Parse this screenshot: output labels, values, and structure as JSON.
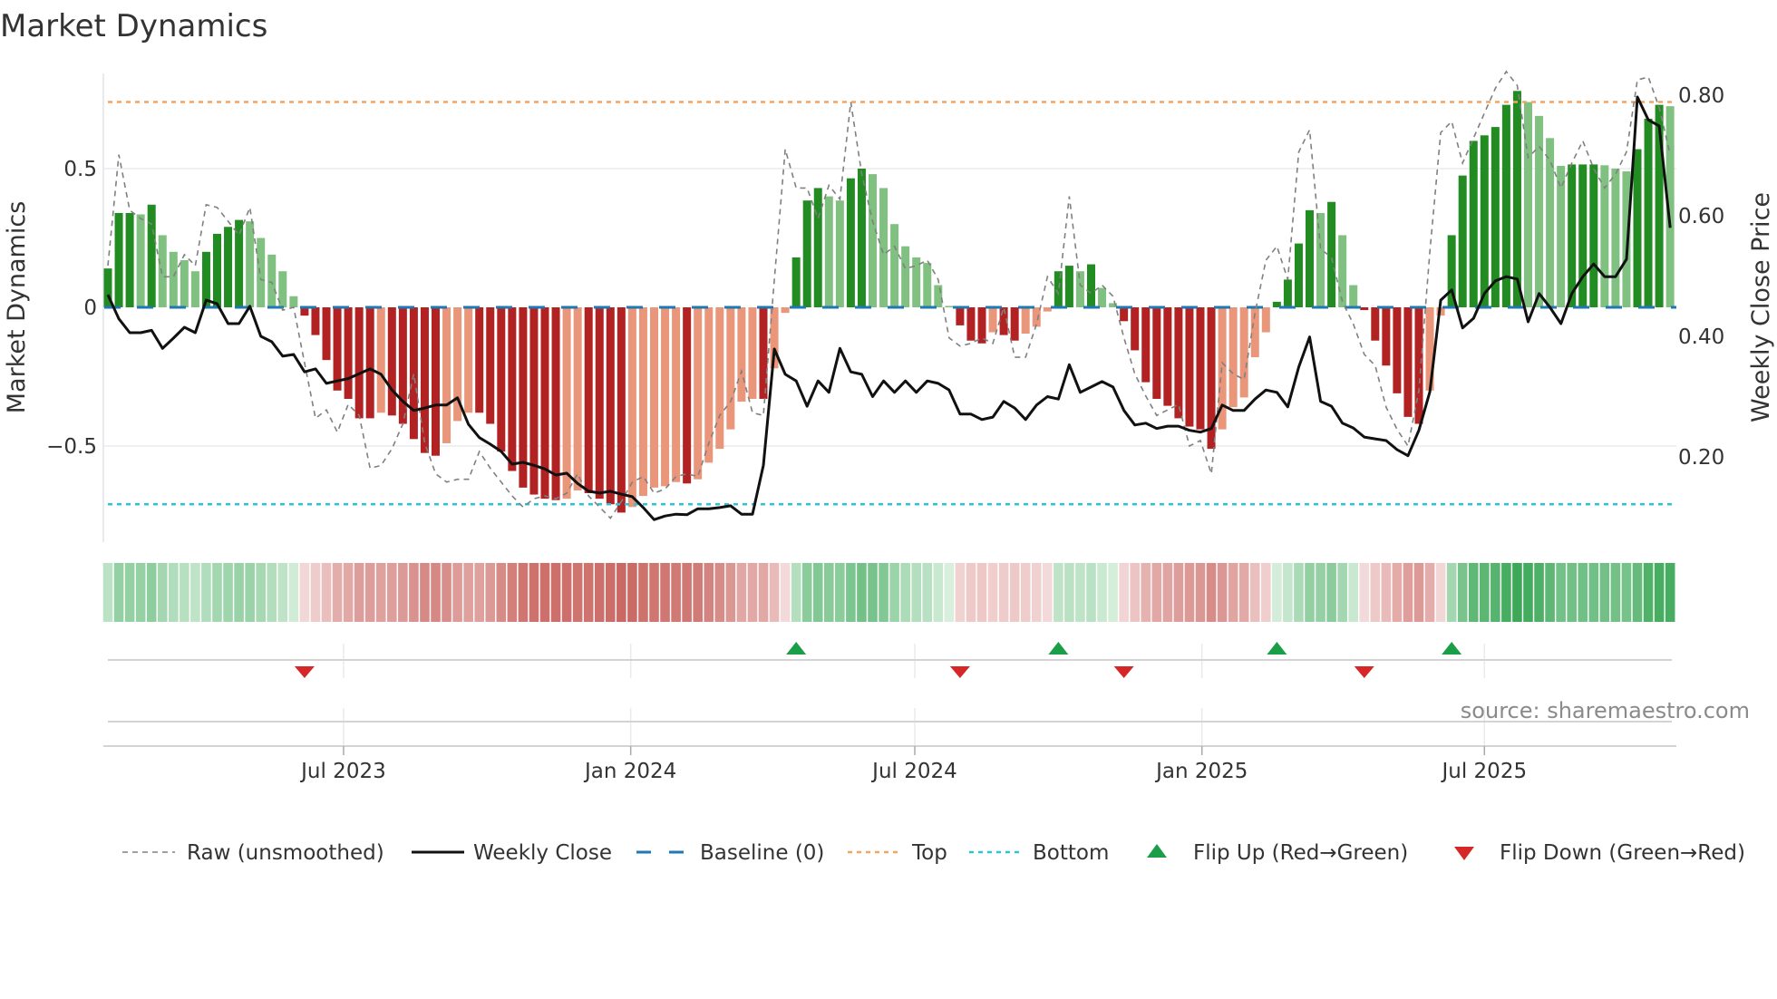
{
  "chart_data": {
    "type": "bar",
    "title": "Market Dynamics",
    "ylabel": "Market Dynamics",
    "y2label": "Weekly Close Price",
    "ylim": [
      -0.85,
      0.85
    ],
    "y2lim": [
      0.07,
      0.89
    ],
    "yticks": [
      {
        "value": 0.5,
        "label": "0.5"
      },
      {
        "value": 0,
        "label": "0"
      },
      {
        "value": -0.5,
        "label": "−0.5"
      }
    ],
    "y2ticks": [
      {
        "value": 0.8,
        "label": "0.80"
      },
      {
        "value": 0.6,
        "label": "0.60"
      },
      {
        "value": 0.4,
        "label": "0.40"
      },
      {
        "value": 0.2,
        "label": "0.20"
      }
    ],
    "xticks": [
      {
        "label": "Jul 2023",
        "date": "2023-07-01"
      },
      {
        "label": "Jan 2024",
        "date": "2024-01-01"
      },
      {
        "label": "Jul 2024",
        "date": "2024-07-01"
      },
      {
        "label": "Jan 2025",
        "date": "2025-01-01"
      },
      {
        "label": "Jul 2025",
        "date": "2025-07-01"
      }
    ],
    "start_date": "2023-01-31",
    "interval_days": 7,
    "top_level": 0.74,
    "bottom_level": -0.71,
    "baseline": 0,
    "series": [
      {
        "name": "Market Dynamics (smoothed)",
        "values": [
          0.14,
          0.34,
          0.34,
          0.335,
          0.37,
          0.26,
          0.2,
          0.17,
          0.13,
          0.2,
          0.265,
          0.29,
          0.315,
          0.31,
          0.25,
          0.19,
          0.13,
          0.04,
          -0.03,
          -0.1,
          -0.19,
          -0.3,
          -0.33,
          -0.4,
          -0.4,
          -0.38,
          -0.39,
          -0.42,
          -0.475,
          -0.525,
          -0.535,
          -0.49,
          -0.41,
          -0.38,
          -0.38,
          -0.42,
          -0.52,
          -0.59,
          -0.65,
          -0.675,
          -0.69,
          -0.695,
          -0.69,
          -0.66,
          -0.67,
          -0.69,
          -0.71,
          -0.74,
          -0.72,
          -0.68,
          -0.65,
          -0.645,
          -0.63,
          -0.635,
          -0.62,
          -0.56,
          -0.51,
          -0.44,
          -0.34,
          -0.33,
          -0.33,
          -0.22,
          -0.02,
          0.18,
          0.385,
          0.43,
          0.4,
          0.385,
          0.465,
          0.5,
          0.48,
          0.43,
          0.3,
          0.22,
          0.18,
          0.16,
          0.08,
          0.005,
          -0.065,
          -0.12,
          -0.13,
          -0.09,
          -0.1,
          -0.12,
          -0.095,
          -0.07,
          -0.015,
          0.13,
          0.15,
          0.13,
          0.155,
          0.07,
          0.015,
          -0.05,
          -0.155,
          -0.27,
          -0.33,
          -0.355,
          -0.4,
          -0.43,
          -0.44,
          -0.51,
          -0.44,
          -0.36,
          -0.325,
          -0.18,
          -0.09,
          0.02,
          0.1,
          0.23,
          0.35,
          0.34,
          0.38,
          0.26,
          0.08,
          -0.01,
          -0.12,
          -0.21,
          -0.31,
          -0.395,
          -0.42,
          -0.3,
          -0.03,
          0.26,
          0.475,
          0.6,
          0.62,
          0.65,
          0.73,
          0.78,
          0.74,
          0.69,
          0.61,
          0.51,
          0.515,
          0.515,
          0.515,
          0.512,
          0.5,
          0.49,
          0.57,
          0.68,
          0.73,
          0.725
        ]
      },
      {
        "name": "Raw (unsmoothed)",
        "values": [
          0.15,
          0.55,
          0.35,
          0.32,
          0.3,
          0.11,
          0.11,
          0.19,
          0.15,
          0.37,
          0.36,
          0.31,
          0.26,
          0.36,
          0.1,
          0.09,
          -0.01,
          0.0,
          -0.2,
          -0.4,
          -0.37,
          -0.45,
          -0.35,
          -0.39,
          -0.58,
          -0.57,
          -0.51,
          -0.42,
          -0.24,
          -0.49,
          -0.6,
          -0.63,
          -0.62,
          -0.62,
          -0.52,
          -0.58,
          -0.63,
          -0.68,
          -0.72,
          -0.69,
          -0.68,
          -0.69,
          -0.67,
          -0.6,
          -0.68,
          -0.72,
          -0.76,
          -0.7,
          -0.63,
          -0.61,
          -0.67,
          -0.655,
          -0.61,
          -0.6,
          -0.61,
          -0.49,
          -0.39,
          -0.34,
          -0.23,
          -0.38,
          -0.39,
          0.1,
          0.57,
          0.43,
          0.43,
          0.32,
          0.44,
          0.39,
          0.74,
          0.48,
          0.31,
          0.19,
          0.22,
          0.14,
          0.15,
          0.17,
          0.1,
          -0.11,
          -0.14,
          -0.13,
          -0.11,
          -0.13,
          0.0,
          -0.18,
          -0.18,
          -0.06,
          0.11,
          0.05,
          0.4,
          0.08,
          0.05,
          0.08,
          0.04,
          -0.11,
          -0.24,
          -0.32,
          -0.39,
          -0.37,
          -0.35,
          -0.5,
          -0.48,
          -0.6,
          -0.2,
          -0.24,
          -0.26,
          -0.02,
          0.17,
          0.22,
          0.1,
          0.56,
          0.64,
          0.21,
          0.18,
          0.02,
          -0.06,
          -0.17,
          -0.21,
          -0.36,
          -0.44,
          -0.5,
          -0.3,
          0.2,
          0.63,
          0.67,
          0.52,
          0.61,
          0.7,
          0.79,
          0.85,
          0.8,
          0.54,
          0.58,
          0.53,
          0.43,
          0.52,
          0.6,
          0.5,
          0.43,
          0.48,
          0.56,
          0.82,
          0.83,
          0.72,
          0.55
        ]
      },
      {
        "name": "Weekly Close",
        "axis": "right",
        "values": [
          0.469,
          0.429,
          0.406,
          0.406,
          0.41,
          0.38,
          0.397,
          0.415,
          0.406,
          0.46,
          0.454,
          0.421,
          0.421,
          0.45,
          0.4,
          0.391,
          0.367,
          0.37,
          0.341,
          0.346,
          0.322,
          0.326,
          0.33,
          0.338,
          0.346,
          0.337,
          0.311,
          0.292,
          0.277,
          0.281,
          0.286,
          0.286,
          0.298,
          0.254,
          0.232,
          0.221,
          0.209,
          0.188,
          0.191,
          0.186,
          0.18,
          0.17,
          0.173,
          0.156,
          0.143,
          0.14,
          0.143,
          0.138,
          0.134,
          0.116,
          0.096,
          0.102,
          0.105,
          0.104,
          0.114,
          0.114,
          0.116,
          0.119,
          0.105,
          0.105,
          0.186,
          0.379,
          0.337,
          0.326,
          0.284,
          0.326,
          0.307,
          0.38,
          0.341,
          0.337,
          0.3,
          0.326,
          0.307,
          0.326,
          0.307,
          0.326,
          0.322,
          0.311,
          0.271,
          0.271,
          0.262,
          0.266,
          0.292,
          0.281,
          0.262,
          0.286,
          0.3,
          0.296,
          0.353,
          0.307,
          0.316,
          0.325,
          0.316,
          0.277,
          0.253,
          0.256,
          0.247,
          0.251,
          0.251,
          0.244,
          0.241,
          0.247,
          0.286,
          0.277,
          0.277,
          0.296,
          0.311,
          0.307,
          0.283,
          0.349,
          0.399,
          0.292,
          0.284,
          0.256,
          0.248,
          0.233,
          0.23,
          0.227,
          0.212,
          0.202,
          0.244,
          0.308,
          0.46,
          0.477,
          0.414,
          0.43,
          0.471,
          0.492,
          0.499,
          0.495,
          0.424,
          0.471,
          0.448,
          0.421,
          0.471,
          0.499,
          0.52,
          0.499,
          0.499,
          0.528,
          0.797,
          0.759,
          0.749,
          0.58
        ]
      }
    ],
    "flip_up_weeks": [
      63,
      87,
      107,
      123
    ],
    "flip_down_weeks": [
      18,
      78,
      93,
      115
    ],
    "legend": {
      "placement": "bottom",
      "items": [
        {
          "key": "raw",
          "label": "Raw (unsmoothed)"
        },
        {
          "key": "close",
          "label": "Weekly Close"
        },
        {
          "key": "baseline",
          "label": "Baseline (0)"
        },
        {
          "key": "top",
          "label": "Top"
        },
        {
          "key": "bottom",
          "label": "Bottom"
        },
        {
          "key": "flip_up",
          "label": "Flip Up (Red→Green)"
        },
        {
          "key": "flip_down",
          "label": "Flip Down (Green→Red)"
        }
      ]
    },
    "source": "source: sharemaestro.com",
    "colors": {
      "green_dark": "#228b22",
      "green_light": "#80c080",
      "red_dark": "#b22222",
      "red_light": "#e9967a",
      "top": "#f4a460",
      "bottom": "#2ec4d8",
      "baseline": "#1f77b4",
      "raw": "#808080",
      "close": "#111111",
      "flip_up": "#1a9e48",
      "flip_down": "#d62728"
    }
  }
}
